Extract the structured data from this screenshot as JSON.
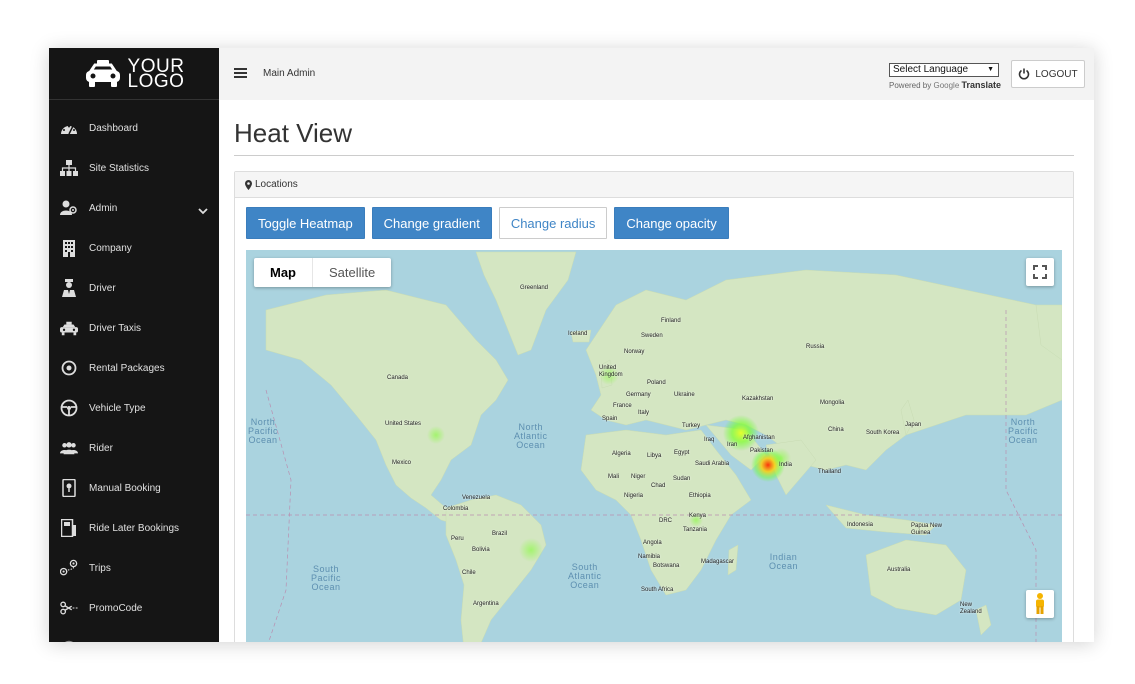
{
  "logo": {
    "line1": "YOUR",
    "line2": "LOGO"
  },
  "sidebar": {
    "items": [
      {
        "label": "Dashboard",
        "icon": "dashboard-icon"
      },
      {
        "label": "Site Statistics",
        "icon": "sitemap-icon"
      },
      {
        "label": "Admin",
        "icon": "admin-users-icon",
        "expandable": true
      },
      {
        "label": "Company",
        "icon": "building-icon"
      },
      {
        "label": "Driver",
        "icon": "driver-icon"
      },
      {
        "label": "Driver Taxis",
        "icon": "taxi-icon"
      },
      {
        "label": "Rental Packages",
        "icon": "target-icon"
      },
      {
        "label": "Vehicle Type",
        "icon": "steering-wheel-icon"
      },
      {
        "label": "Rider",
        "icon": "group-icon"
      },
      {
        "label": "Manual Booking",
        "icon": "booking-icon"
      },
      {
        "label": "Ride Later Bookings",
        "icon": "calendar-booking-icon"
      },
      {
        "label": "Trips",
        "icon": "route-icon"
      },
      {
        "label": "PromoCode",
        "icon": "scissors-icon"
      }
    ]
  },
  "header": {
    "breadcrumb": "Main  Admin",
    "language_select": "Select Language",
    "powered_by": "Powered by",
    "google": "Google",
    "translate": "Translate",
    "logout_label": "LOGOUT"
  },
  "page": {
    "title": "Heat View",
    "panel_title": "Locations",
    "buttons": {
      "toggle_heatmap": "Toggle Heatmap",
      "change_gradient": "Change gradient",
      "change_radius": "Change radius",
      "change_opacity": "Change opacity"
    }
  },
  "map": {
    "type_map": "Map",
    "type_satellite": "Satellite",
    "oceans": {
      "north_pacific_left": "North\nPacific\nOcean",
      "north_atlantic": "North\nAtlantic\nOcean",
      "north_pacific_right": "North\nPacific\nOcean",
      "south_pacific": "South\nPacific\nOcean",
      "south_atlantic": "South\nAtlantic\nOcean",
      "indian": "Indian\nOcean"
    },
    "countries": {
      "greenland": "Greenland",
      "iceland": "Iceland",
      "finland": "Finland",
      "sweden": "Sweden",
      "norway": "Norway",
      "russia": "Russia",
      "canada": "Canada",
      "united_kingdom": "United\nKingdom",
      "poland": "Poland",
      "germany": "Germany",
      "ukraine": "Ukraine",
      "france": "France",
      "kazakhstan": "Kazakhstan",
      "mongolia": "Mongolia",
      "spain": "Spain",
      "italy": "Italy",
      "turkey": "Turkey",
      "china": "China",
      "south_korea": "South Korea",
      "japan": "Japan",
      "united_states": "United States",
      "afghanistan": "Afghanistan",
      "iran": "Iran",
      "iraq": "Iraq",
      "pakistan": "Pakistan",
      "india": "India",
      "algeria": "Algeria",
      "libya": "Libya",
      "egypt": "Egypt",
      "saudi_arabia": "Saudi Arabia",
      "mexico": "Mexico",
      "thailand": "Thailand",
      "mali": "Mali",
      "niger": "Niger",
      "chad": "Chad",
      "sudan": "Sudan",
      "nigeria": "Nigeria",
      "ethiopia": "Ethiopia",
      "venezuela": "Venezuela",
      "colombia": "Colombia",
      "kenya": "Kenya",
      "drc": "DRC",
      "tanzania": "Tanzania",
      "indonesia": "Indonesia",
      "brazil": "Brazil",
      "peru": "Peru",
      "papua_new_guinea": "Papua New\nGuinea",
      "angola": "Angola",
      "bolivia": "Bolivia",
      "namibia": "Namibia",
      "madagascar": "Madagascar",
      "botswana": "Botswana",
      "australia": "Australia",
      "chile": "Chile",
      "south_africa": "South Africa",
      "argentina": "Argentina",
      "new_zealand": "New\nZealand"
    }
  },
  "colors": {
    "sidebar_bg": "#151515",
    "primary": "#3f85c6",
    "ocean": "#aad3df",
    "land": "#d7e8c5"
  }
}
